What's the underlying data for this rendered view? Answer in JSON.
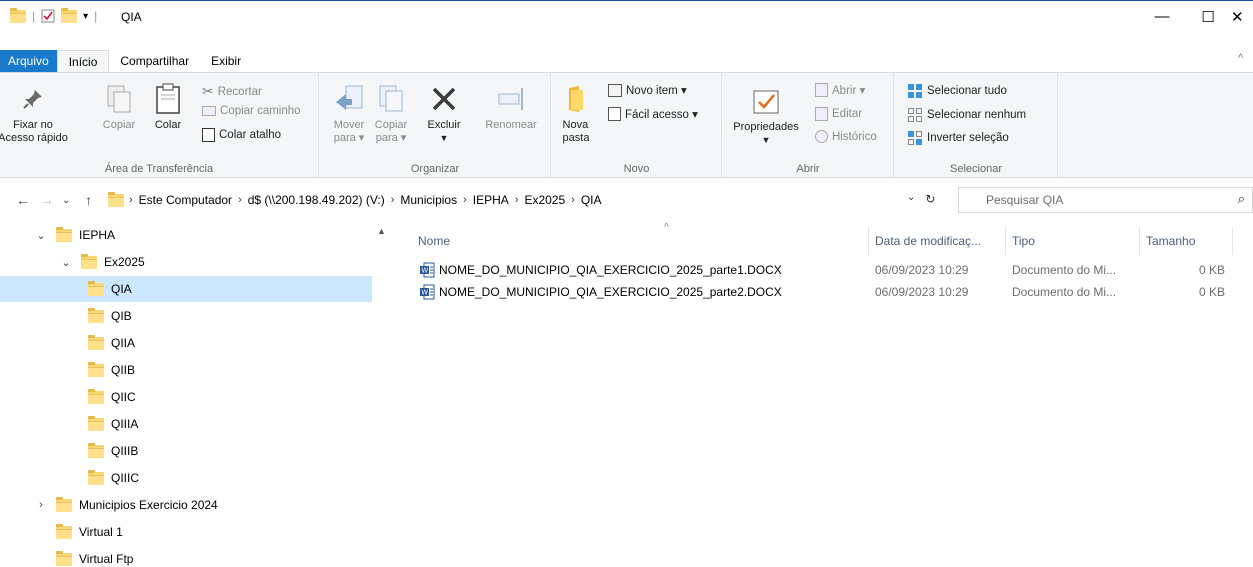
{
  "window": {
    "title": "QIA",
    "controls": {
      "minimize": "—",
      "maximize": "☐",
      "close": "✕"
    }
  },
  "ribbon_tabs": [
    "Arquivo",
    "Início",
    "Compartilhar",
    "Exibir"
  ],
  "ribbon": {
    "clipboard": {
      "pin_label": "Fixar no\nAcesso rápido",
      "copy_label": "Copiar",
      "paste_label": "Colar",
      "cut_label": "Recortar",
      "copy_path_label": "Copiar caminho",
      "paste_shortcut_label": "Colar atalho",
      "group_label": "Área de Transferência"
    },
    "organize": {
      "move_label": "Mover\npara ▾",
      "copyto_label": "Copiar\npara ▾",
      "delete_label": "Excluir",
      "rename_label": "Renomear",
      "group_label": "Organizar"
    },
    "new": {
      "new_folder_label": "Nova\npasta",
      "new_item_label": "Novo item ▾",
      "easy_access_label": "Fácil acesso ▾",
      "group_label": "Novo"
    },
    "open": {
      "properties_label": "Propriedades",
      "open_label": "Abrir ▾",
      "edit_label": "Editar",
      "history_label": "Histórico",
      "group_label": "Abrir"
    },
    "select": {
      "select_all_label": "Selecionar tudo",
      "select_none_label": "Selecionar nenhum",
      "invert_label": "Inverter seleção",
      "group_label": "Selecionar"
    }
  },
  "address": {
    "crumbs": [
      "Este Computador",
      "d$ (\\\\200.198.49.202) (V:)",
      "Municipios",
      "IEPHA",
      "Ex2025",
      "QIA"
    ],
    "search_placeholder": "Pesquisar QIA"
  },
  "nav_tree": [
    {
      "label": "IEPHA",
      "level": 0,
      "expand": "⌄",
      "selected": false
    },
    {
      "label": "Ex2025",
      "level": 1,
      "expand": "⌄",
      "selected": false
    },
    {
      "label": "QIA",
      "level": 2,
      "expand": "",
      "selected": true
    },
    {
      "label": "QIB",
      "level": 2,
      "expand": "",
      "selected": false
    },
    {
      "label": "QIIA",
      "level": 2,
      "expand": "",
      "selected": false
    },
    {
      "label": "QIIB",
      "level": 2,
      "expand": "",
      "selected": false
    },
    {
      "label": "QIIC",
      "level": 2,
      "expand": "",
      "selected": false
    },
    {
      "label": "QIIIA",
      "level": 2,
      "expand": "",
      "selected": false
    },
    {
      "label": "QIIIB",
      "level": 2,
      "expand": "",
      "selected": false
    },
    {
      "label": "QIIIC",
      "level": 2,
      "expand": "",
      "selected": false
    },
    {
      "label": "Municipios Exercicio 2024",
      "level": 0,
      "expand": "›",
      "selected": false
    },
    {
      "label": "Virtual 1",
      "level": 0,
      "expand": "",
      "selected": false
    },
    {
      "label": "Virtual Ftp",
      "level": 0,
      "expand": "",
      "selected": false
    }
  ],
  "columns": {
    "name": "Nome",
    "date": "Data de modificaç...",
    "type": "Tipo",
    "size": "Tamanho"
  },
  "files": [
    {
      "name": "NOME_DO_MUNICIPIO_QIA_EXERCICIO_2025_parte1.DOCX",
      "date": "06/09/2023 10:29",
      "type": "Documento do Mi...",
      "size": "0 KB"
    },
    {
      "name": "NOME_DO_MUNICIPIO_QIA_EXERCICIO_2025_parte2.DOCX",
      "date": "06/09/2023 10:29",
      "type": "Documento do Mi...",
      "size": "0 KB"
    }
  ],
  "colors": {
    "accent": "#1979ca",
    "selection": "#cce8ff",
    "folder": "#f8d775"
  }
}
